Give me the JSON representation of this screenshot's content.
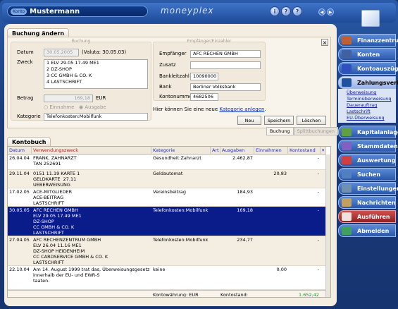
{
  "header": {
    "konto_tag": "Konto",
    "account_name": "Mustermann",
    "brand": "moneyplex",
    "help_icons": [
      "i",
      "?",
      "?"
    ],
    "nav_prev": "◀",
    "nav_next": "▶"
  },
  "form": {
    "title": "Buchung ändern",
    "buchung_caption": "Buchung",
    "empfaenger_caption": "Empfänger/Einzahler",
    "datum_label": "Datum",
    "datum_value": "30.05.2005",
    "valuta": "(Valuta: 30.05.03)",
    "zweck_label": "Zweck",
    "zweck_lines": [
      "1 ELV 29.05 17.49 ME1",
      "2 DZ-SHOP",
      "3 CC GMBH & CO. K",
      "4 LASTSCHRIFT"
    ],
    "betrag_label": "Betrag",
    "betrag_value": "169,18",
    "currency": "EUR",
    "radio_einnahme": "Einnahme",
    "radio_ausgabe": "Ausgabe",
    "kategorie_label": "Kategorie",
    "kategorie_value": "Telefonkosten:Mobilfunk",
    "empf_label": "Empfänger",
    "empf_value": "AFC RECHEN GMBH",
    "zusatz_label": "Zusatz",
    "zusatz_value": "",
    "blz_label": "Bankleitzahl",
    "blz_value": "10090000",
    "bank_label": "Bank",
    "bank_value": "Berliner Volksbank",
    "kto_label": "Kontonummer",
    "kto_value": "4682506",
    "hint_prefix": "Hier können Sie eine neue ",
    "hint_link": "Kategorie anlegen",
    "hint_suffix": ".",
    "btn_neu": "Neu",
    "btn_speichern": "Speichern",
    "btn_loeschen": "Löschen",
    "close": "×"
  },
  "tabs": [
    "Buchung",
    "Splittbuchungen"
  ],
  "kontobuch": {
    "title": "Kontobuch",
    "columns": [
      "Datum",
      "Verwendungszweck",
      "Kategorie",
      "Art",
      "Ausgaben",
      "Einnahmen",
      "Kontostand"
    ],
    "rows": [
      {
        "datum": "26.04.04",
        "zweck": "FRANK, ZAHNARZT\nTAN 252691",
        "kategorie": "Gesundheit:Zahnarzt",
        "art": "",
        "aus": "2.462,87",
        "ein": "",
        "stand": "-"
      },
      {
        "datum": "29.11.04",
        "zweck": "0151 11.19 KARTE 1\nGELDKARTE  27.11\nUEBERWEISUNG",
        "kategorie": "Geldautomat",
        "art": "",
        "aus": "",
        "ein": "20,83",
        "stand": "-"
      },
      {
        "datum": "17.02.05",
        "zweck": "ACE-MITGLIEDER\nACE-BEITRAG\nLASTSCHRIFT",
        "kategorie": "Vereinsbeitrag",
        "art": "",
        "aus": "184,93",
        "ein": "",
        "stand": "-"
      },
      {
        "datum": "30.05.05",
        "zweck": "AFC RECHEN GMBH\nELV 29.05 17.49 ME1\nDZ-SHOP\nCC GMBH & CO. K\nLASTSCHRIFT",
        "kategorie": "Telefonkosten:Mobilfunk",
        "art": "",
        "aus": "169,18",
        "ein": "",
        "stand": "-"
      },
      {
        "datum": "27.04.05",
        "zweck": "AFC RECHENZENTRUM GMBH\nELV 26.04 11.16 ME1\nDZ-SHOP HEIDENHEIM\nCC CARDSERVICE GMBH & CO. K\nLASTSCHRIFT",
        "kategorie": "Telefonkosten:Mobilfunk",
        "art": "",
        "aus": "234,77",
        "ein": "",
        "stand": "-"
      },
      {
        "datum": "22.10.04",
        "zweck": "Am 14. August 1999 trat das, Überweisungsgesetz in\ninnerhalb der EU- und EWR-S\ntaaten.",
        "kategorie": "keine",
        "art": "",
        "aus": "",
        "ein": "0,00",
        "stand": "-"
      }
    ],
    "footer_waehrung": "Kontowährung: EUR",
    "footer_stand_label": "Kontostand:",
    "footer_stand": "1.652,42"
  },
  "sidebar": {
    "items": [
      "Finanzzentrum",
      "Konten",
      "Kontoauszüge",
      "Zahlungsverkehr",
      "Kapitalanlage",
      "Stammdaten",
      "Auswertung",
      "Suchen",
      "Einstellungen",
      "Nachrichten",
      "Ausführen",
      "Abmelden"
    ],
    "sub_items": [
      "Überweisung",
      "Terminüberweisung",
      "Dauerauftrag",
      "Lastschrift",
      "EU-Überweisung"
    ]
  },
  "colors": {
    "selection": "#0a1b8a",
    "positive": "#10a020",
    "header_blue": "#2030c0",
    "sidebar": "#2a58a8"
  }
}
